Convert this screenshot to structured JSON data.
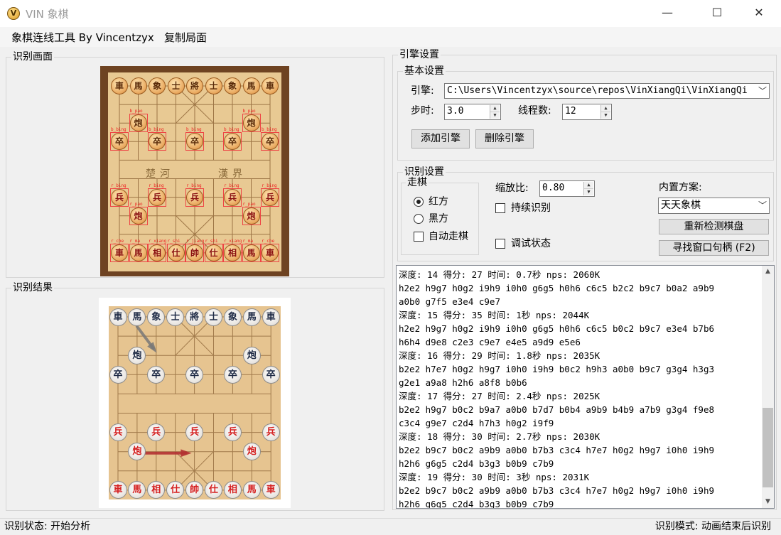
{
  "window": {
    "title": "VIN 象棋",
    "icon": "V",
    "minimize": "—",
    "maximize": "☐",
    "close": "✕"
  },
  "menu": {
    "items": [
      "象棋连线工具 By Vincentzyx",
      "复制局面"
    ]
  },
  "panels": {
    "capture_title": "识别画面",
    "result_title": "识别结果"
  },
  "board_labels": {
    "river_left": "楚河",
    "river_right": "漢界"
  },
  "capture_board": {
    "tags": [
      "b_pao",
      "b_pao",
      "b_bing",
      "b_bing",
      "b_bing",
      "b_bing",
      "b_bing",
      "r_bing",
      "r_bing",
      "r_bing",
      "r_bing",
      "r_bing",
      "r_pao",
      "r_pao",
      "r_che",
      "r_ma",
      "r_xiang",
      "r_shi",
      "r_jiang",
      "r_shi",
      "r_xiang",
      "r_ma",
      "r_che"
    ],
    "rows": [
      {
        "y": 0,
        "color": "black",
        "pieces": [
          "車",
          "馬",
          "象",
          "士",
          "將",
          "士",
          "象",
          "馬",
          "車"
        ]
      },
      {
        "y": 2,
        "color": "black",
        "pieces": [
          "",
          "炮",
          "",
          "",
          "",
          "",
          "",
          "炮",
          ""
        ]
      },
      {
        "y": 3,
        "color": "black",
        "pieces": [
          "卒",
          "",
          "卒",
          "",
          "卒",
          "",
          "卒",
          "",
          "卒"
        ]
      },
      {
        "y": 6,
        "color": "red",
        "pieces": [
          "兵",
          "",
          "兵",
          "",
          "兵",
          "",
          "兵",
          "",
          "兵"
        ]
      },
      {
        "y": 7,
        "color": "red",
        "pieces": [
          "",
          "炮",
          "",
          "",
          "",
          "",
          "",
          "炮",
          ""
        ]
      },
      {
        "y": 9,
        "color": "red",
        "pieces": [
          "車",
          "馬",
          "相",
          "仕",
          "帥",
          "仕",
          "相",
          "馬",
          "車"
        ]
      }
    ]
  },
  "result_board": {
    "rows": [
      {
        "y": 0,
        "color": "black",
        "pieces": [
          "車",
          "馬",
          "象",
          "士",
          "將",
          "士",
          "象",
          "馬",
          "車"
        ]
      },
      {
        "y": 2,
        "color": "black",
        "pieces": [
          "",
          "炮",
          "",
          "",
          "",
          "",
          "",
          "炮",
          ""
        ]
      },
      {
        "y": 3,
        "color": "black",
        "pieces": [
          "卒",
          "",
          "卒",
          "",
          "卒",
          "",
          "卒",
          "",
          "卒"
        ]
      },
      {
        "y": 6,
        "color": "red",
        "pieces": [
          "兵",
          "",
          "兵",
          "",
          "兵",
          "",
          "兵",
          "",
          "兵"
        ]
      },
      {
        "y": 7,
        "color": "red",
        "pieces": [
          "",
          "炮",
          "",
          "",
          "",
          "",
          "",
          "炮",
          ""
        ]
      },
      {
        "y": 9,
        "color": "red",
        "pieces": [
          "車",
          "馬",
          "相",
          "仕",
          "帥",
          "仕",
          "相",
          "馬",
          "車"
        ]
      }
    ]
  },
  "engine": {
    "title": "引擎设置",
    "basic_title": "基本设置",
    "engine_label": "引擎:",
    "engine_path": "C:\\Users\\Vincentzyx\\source\\repos\\VinXiangQi\\VinXiangQi",
    "step_label": "步时:",
    "step_value": "3.0",
    "threads_label": "线程数:",
    "threads_value": "12",
    "add_button": "添加引擎",
    "remove_button": "删除引擎"
  },
  "recognition": {
    "title": "识别设置",
    "move_group": "走棋",
    "red_side": "红方",
    "black_side": "黑方",
    "auto_move": "自动走棋",
    "scale_label": "缩放比:",
    "scale_value": "0.80",
    "continuous": "持续识别",
    "debug": "调试状态",
    "preset_label": "内置方案:",
    "preset_value": "天天象棋",
    "redetect_button": "重新检测棋盘",
    "find_window_button": "寻找窗口句柄 (F2)"
  },
  "log": {
    "lines": [
      "深度: 14 得分: 27 时间: 0.7秒 nps: 2060K",
      "h2e2 h9g7 h0g2 i9h9 i0h0 g6g5 h0h6 c6c5 b2c2 b9c7 b0a2 a9b9",
      "a0b0 g7f5 e3e4 c9e7",
      "深度: 15 得分: 35 时间: 1秒 nps: 2044K",
      "h2e2 h9g7 h0g2 i9h9 i0h0 g6g5 h0h6 c6c5 b0c2 b9c7 e3e4 b7b6",
      "h6h4 d9e8 c2e3 c9e7 e4e5 a9d9 e5e6",
      "深度: 16 得分: 29 时间: 1.8秒 nps: 2035K",
      "b2e2 h7e7 h0g2 h9g7 i0h0 i9h9 b0c2 h9h3 a0b0 b9c7 g3g4 h3g3",
      "g2e1 a9a8 h2h6 a8f8 b0b6",
      "深度: 17 得分: 27 时间: 2.4秒 nps: 2025K",
      "b2e2 h9g7 b0c2 b9a7 a0b0 b7d7 b0b4 a9b9 b4b9 a7b9 g3g4 f9e8",
      "c3c4 g9e7 c2d4 h7h3 h0g2 i9f9",
      "深度: 18 得分: 30 时间: 2.7秒 nps: 2030K",
      "b2e2 b9c7 b0c2 a9b9 a0b0 b7b3 c3c4 h7e7 h0g2 h9g7 i0h0 i9h9",
      "h2h6 g6g5 c2d4 b3g3 b0b9 c7b9",
      "深度: 19 得分: 30 时间: 3秒 nps: 2031K",
      "b2e2 b9c7 b0c2 a9b9 a0b0 b7b3 c3c4 h7e7 h0g2 h9g7 i0h0 i9h9",
      "h2h6 g6g5 c2d4 b3g3 b0b9 c7b9"
    ]
  },
  "status": {
    "left": "识别状态: 开始分析",
    "right": "识别模式: 动画结束后识别"
  }
}
